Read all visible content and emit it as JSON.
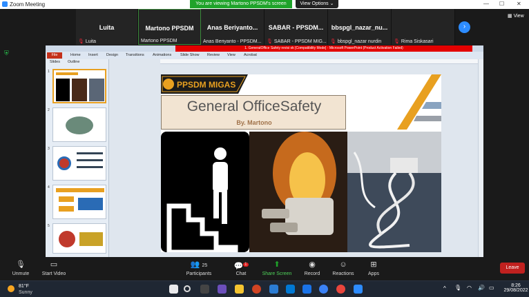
{
  "window": {
    "title": "Zoom Meeting"
  },
  "banner": {
    "viewing": "You are viewing Martono PPSDM's screen",
    "view_options": "View Options"
  },
  "participants_strip": [
    {
      "name": "Luita",
      "sub": "Luita"
    },
    {
      "name": "Martono PPSDM",
      "sub": "Martono PPSDM"
    },
    {
      "name": "Anas Beriyanto...",
      "sub": "Anas Beriyanto - PPSDM..."
    },
    {
      "name": "SABAR - PPSDM...",
      "sub": "SABAR - PPSDM MIG..."
    },
    {
      "name": "bbspgl_nazar_nu...",
      "sub": "bbspgl_nazar nurdin"
    },
    {
      "name": "",
      "sub": "Rima Siskasari"
    }
  ],
  "view_label": "View",
  "powerpoint": {
    "title": "1. GeneralOffice Safety revisi ok [Compatibility Mode] - Microsoft PowerPoint (Product Activation Failed)",
    "file_tab": "File",
    "tabs": [
      "Home",
      "Insert",
      "Design",
      "Transitions",
      "Animations",
      "Slide Show",
      "Review",
      "View",
      "Acrobat"
    ],
    "panel_tabs": [
      "Slides",
      "Outline"
    ],
    "thumb_numbers": [
      "1",
      "2",
      "3",
      "4",
      "5"
    ]
  },
  "slide": {
    "brand": "PPSDM MIGAS",
    "title": "General OfficeSafety",
    "byline": "By. Martono"
  },
  "controls": {
    "unmute": "Unmute",
    "start_video": "Start Video",
    "participants": "Participants",
    "participants_count": "25",
    "chat": "Chat",
    "chat_badge": "1",
    "share_screen": "Share Screen",
    "record": "Record",
    "reactions": "Reactions",
    "apps": "Apps",
    "leave": "Leave"
  },
  "taskbar": {
    "temp": "81°F",
    "weather": "Sunny",
    "time": "8:26",
    "date": "29/08/2022"
  },
  "colors": {
    "zoom_blue": "#2d8cff",
    "viewing_green": "#1fa32a",
    "leave_red": "#c0211f",
    "ppt_title_red": "#e30000",
    "accent_orange": "#e8a020"
  }
}
